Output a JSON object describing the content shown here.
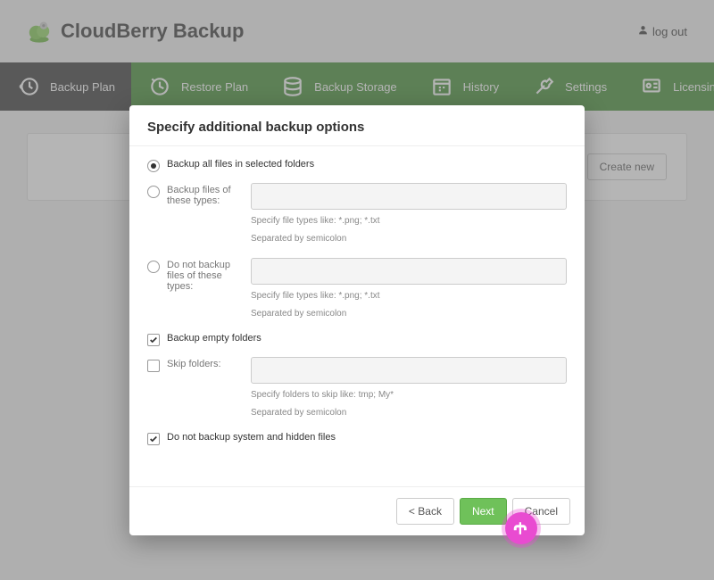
{
  "header": {
    "brand": "CloudBerry Backup",
    "logout": "log out"
  },
  "nav": {
    "items": [
      {
        "label": "Backup Plan"
      },
      {
        "label": "Restore Plan"
      },
      {
        "label": "Backup Storage"
      },
      {
        "label": "History"
      },
      {
        "label": "Settings"
      },
      {
        "label": "Licensing"
      }
    ]
  },
  "page": {
    "create_new": "Create new"
  },
  "modal": {
    "title": "Specify additional backup options",
    "opt_backup_all": "Backup all files in selected folders",
    "opt_include_types": "Backup files of these types:",
    "opt_exclude_types": "Do not backup files of these types:",
    "filetype_hint1": "Specify file types like: *.png; *.txt",
    "filetype_hint2": "Separated by semicolon",
    "opt_empty_folders": "Backup empty folders",
    "opt_skip_folders": "Skip folders:",
    "folders_hint1": "Specify folders to skip like: tmp; My*",
    "folders_hint2": "Separated by semicolon",
    "opt_skip_system": "Do not backup system and hidden files",
    "include_value": "",
    "exclude_value": "",
    "skip_value": "",
    "back": "< Back",
    "next": "Next",
    "cancel": "Cancel"
  }
}
